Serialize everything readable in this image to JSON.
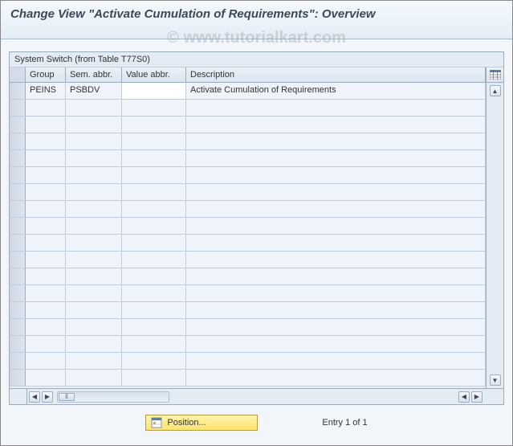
{
  "title": "Change View \"Activate Cumulation of Requirements\": Overview",
  "watermark": "© www.tutorialkart.com",
  "panel": {
    "title": "System Switch (from Table T77S0)",
    "columns": {
      "group": "Group",
      "sem": "Sem. abbr.",
      "value": "Value abbr.",
      "desc": "Description"
    },
    "rows": [
      {
        "group": "PEINS",
        "sem": "PSBDV",
        "value": "",
        "desc": "Activate Cumulation of Requirements"
      }
    ]
  },
  "footer": {
    "position_label": "Position...",
    "entry_text": "Entry 1 of 1"
  }
}
